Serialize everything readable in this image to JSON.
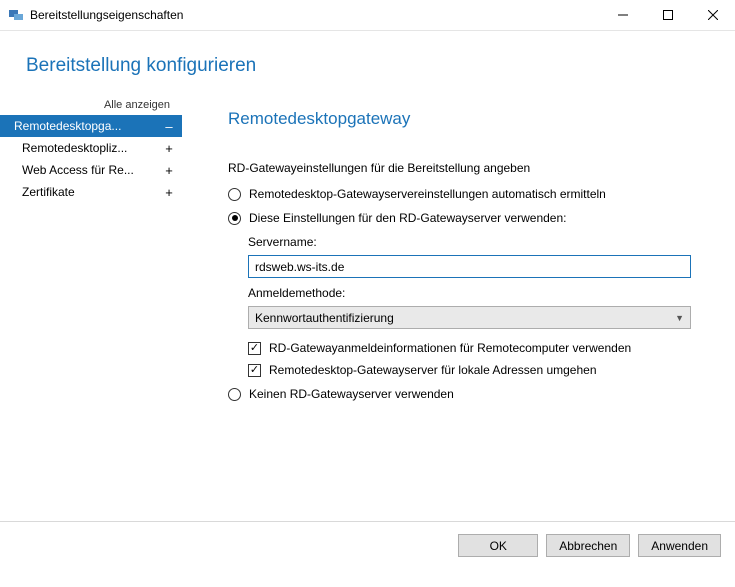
{
  "window": {
    "title": "Bereitstellungseigenschaften"
  },
  "header": {
    "title": "Bereitstellung konfigurieren"
  },
  "sidebar": {
    "show_all": "Alle anzeigen",
    "items": [
      {
        "label": "Remotedesktopga...",
        "expander": "–",
        "active": true
      },
      {
        "label": "Remotedesktopliz...",
        "expander": "+",
        "active": false
      },
      {
        "label": "Web Access für Re...",
        "expander": "+",
        "active": false
      },
      {
        "label": "Zertifikate",
        "expander": "+",
        "active": false
      }
    ]
  },
  "main": {
    "section_title": "Remotedesktopgateway",
    "intro": "RD-Gatewayeinstellungen für die Bereitstellung angeben",
    "radios": {
      "auto": "Remotedesktop-Gatewayservereinstellungen automatisch ermitteln",
      "use_these": "Diese Einstellungen für den RD-Gatewayserver verwenden:",
      "none": "Keinen RD-Gatewayserver verwenden",
      "selected": "use_these"
    },
    "servername_label": "Servername:",
    "servername_value": "rdsweb.ws-its.de",
    "auth_label": "Anmeldemethode:",
    "auth_value": "Kennwortauthentifizierung",
    "checks": {
      "use_creds": "RD-Gatewayanmeldeinformationen für Remotecomputer verwenden",
      "bypass_local": "Remotedesktop-Gatewayserver für lokale Adressen umgehen"
    }
  },
  "footer": {
    "ok": "OK",
    "cancel": "Abbrechen",
    "apply": "Anwenden"
  }
}
